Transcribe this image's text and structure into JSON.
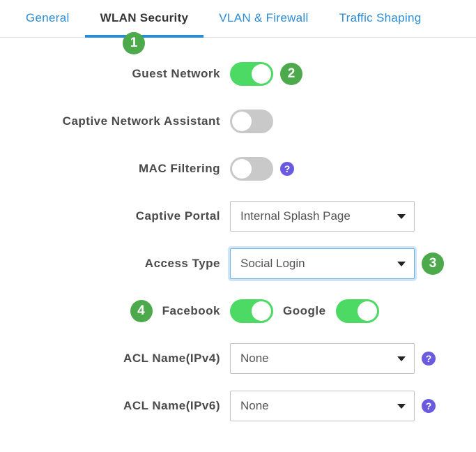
{
  "tabs": {
    "general": "General",
    "wlan_security": "WLAN Security",
    "vlan_firewall": "VLAN & Firewall",
    "traffic_shaping": "Traffic Shaping"
  },
  "markers": {
    "m1": "1",
    "m2": "2",
    "m3": "3",
    "m4": "4"
  },
  "labels": {
    "guest_network": "Guest Network",
    "captive_assistant": "Captive Network Assistant",
    "mac_filtering": "MAC Filtering",
    "captive_portal": "Captive Portal",
    "access_type": "Access Type",
    "facebook": "Facebook",
    "google": "Google",
    "acl_ipv4": "ACL Name(IPv4)",
    "acl_ipv6": "ACL Name(IPv6)"
  },
  "values": {
    "captive_portal": "Internal Splash Page",
    "access_type": "Social Login",
    "acl_ipv4": "None",
    "acl_ipv6": "None"
  },
  "toggles": {
    "guest_network": true,
    "captive_assistant": false,
    "mac_filtering": false,
    "facebook": true,
    "google": true
  },
  "help_glyph": "?"
}
